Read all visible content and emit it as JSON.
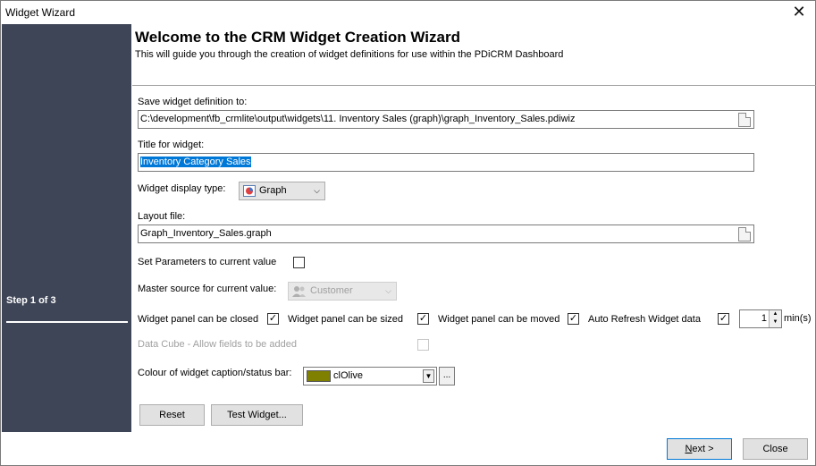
{
  "window": {
    "title": "Widget Wizard",
    "close_glyph": "✕"
  },
  "sidebar": {
    "step_label": "Step 1 of 3"
  },
  "header": {
    "title": "Welcome to the CRM Widget Creation Wizard",
    "subtitle": "This will guide you through the creation of widget definitions for use within the PDiCRM Dashboard"
  },
  "form": {
    "save_label": "Save widget definition to:",
    "save_path": "C:\\development\\fb_crmlite\\output\\widgets\\11. Inventory Sales (graph)\\graph_Inventory_Sales.pdiwiz",
    "title_label": "Title for widget:",
    "title_value": "Inventory Category Sales",
    "display_type_label": "Widget display type:",
    "display_type_value": "Graph",
    "layout_label": "Layout file:",
    "layout_value": "Graph_Inventory_Sales.graph",
    "set_params_label": "Set Parameters to current value",
    "set_params_checked": false,
    "master_source_label": "Master source for current value:",
    "master_source_value": "Customer",
    "can_close_label": "Widget panel can be closed",
    "can_close_check": "✓",
    "can_size_label": "Widget panel can be sized",
    "can_size_check": "✓",
    "can_move_label": "Widget panel can be moved",
    "can_move_check": "✓",
    "auto_refresh_label": "Auto Refresh Widget data",
    "auto_refresh_check": "✓",
    "refresh_value": "1",
    "refresh_unit": "min(s)",
    "data_cube_label": "Data Cube - Allow fields to be added",
    "colour_label": "Colour of widget caption/status bar:",
    "colour_value": "clOlive",
    "colour_hex": "#808000"
  },
  "buttons": {
    "reset": "Reset",
    "test_widget": "Test Widget...",
    "next_prefix": "N",
    "next_rest": "ext >",
    "close": "Close"
  }
}
